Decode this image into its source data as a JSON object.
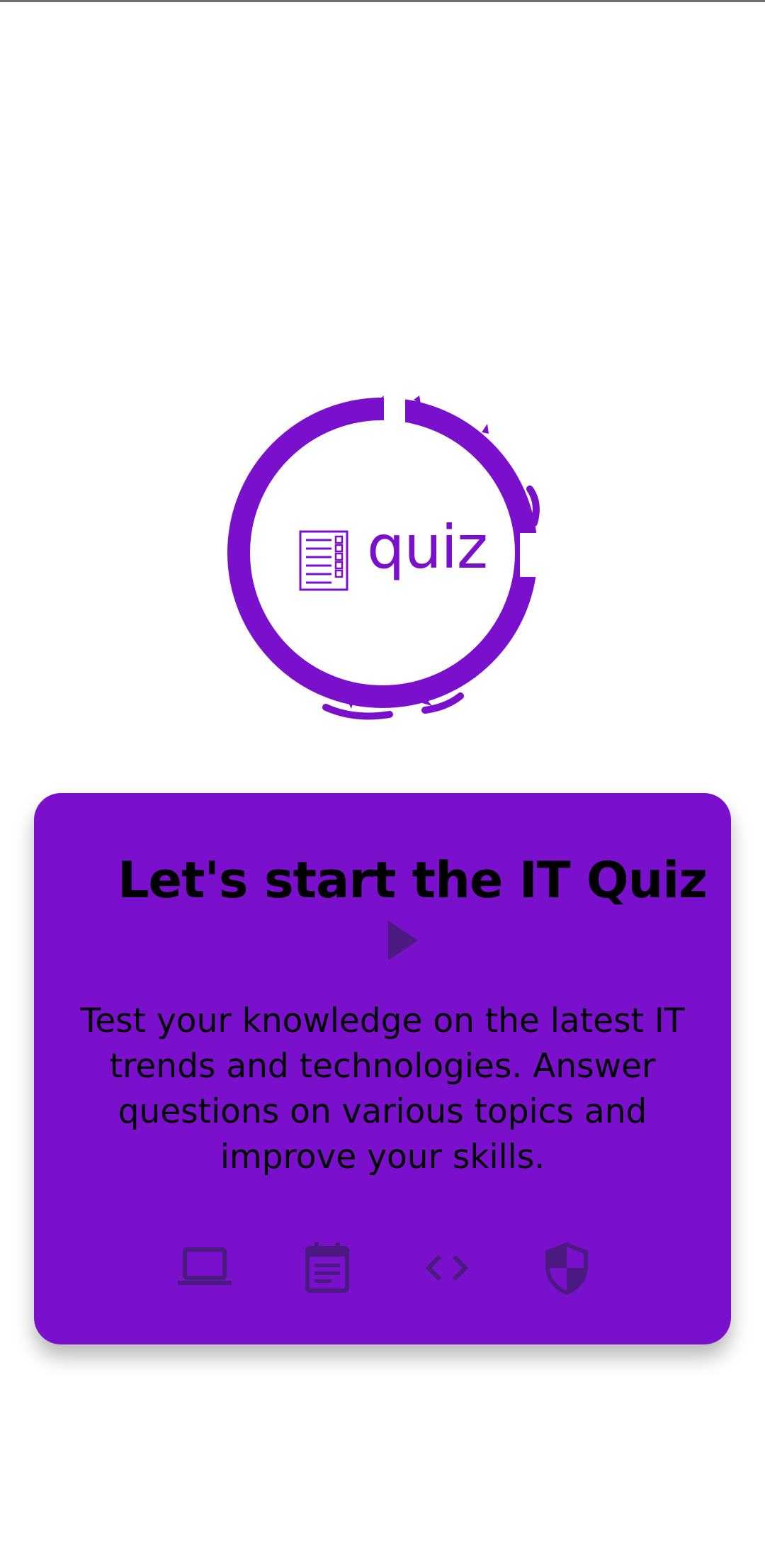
{
  "logo": {
    "text": "quiz",
    "icon": "checklist-document-icon",
    "ring_color": "#7a10cc"
  },
  "card": {
    "title": "Let's start the IT Quiz",
    "play_icon": "play-arrow-icon",
    "description": "Test your knowledge on the latest IT trends and technologies. Answer questions on various topics and improve your skills.",
    "background_color": "#7a10cc",
    "icons": [
      "laptop-icon",
      "calendar-note-icon",
      "code-icon",
      "security-shield-icon"
    ]
  },
  "colors": {
    "accent": "#7a10cc",
    "icon_dark": "#4a1a80",
    "text": "#000000",
    "background": "#ffffff"
  }
}
